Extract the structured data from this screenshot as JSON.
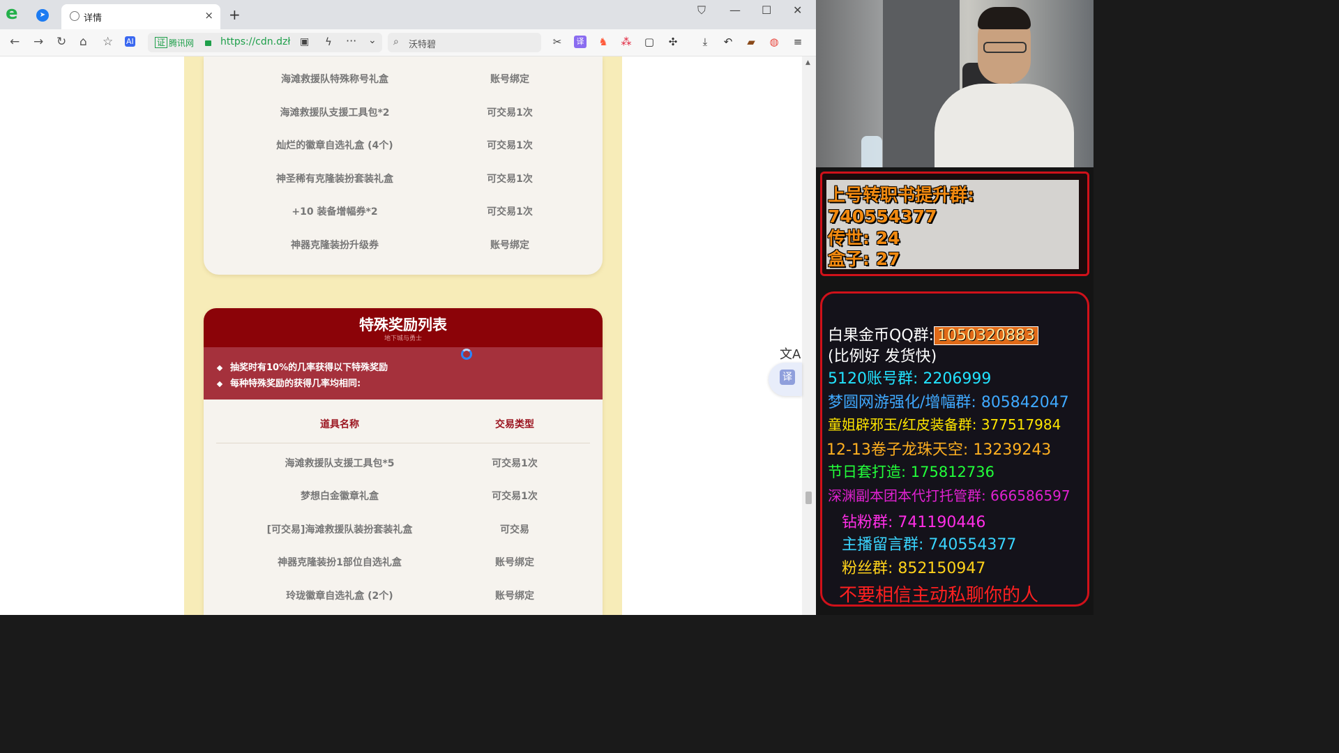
{
  "browser": {
    "tab_title": "详情",
    "tab_close": "×",
    "new_tab": "+",
    "cert_mark": "证",
    "cert_name": "腾讯网",
    "url": "https://cdn.dzł",
    "search_placeholder": "沃特碧"
  },
  "card1": {
    "rows": [
      {
        "name": "海滩救援队特殊称号礼盒",
        "type": "账号绑定"
      },
      {
        "name": "海滩救援队支援工具包*2",
        "type": "可交易1次"
      },
      {
        "name": "灿烂的徽章自选礼盒 (4个)",
        "type": "可交易1次"
      },
      {
        "name": "神圣稀有克隆装扮套装礼盒",
        "type": "可交易1次"
      },
      {
        "name": "+10 装备增幅券*2",
        "type": "可交易1次"
      },
      {
        "name": "神器克隆装扮升级券",
        "type": "账号绑定"
      }
    ]
  },
  "card2": {
    "title": "特殊奖励列表",
    "subtitle": "地下城与勇士",
    "notes": [
      "抽奖时有10%的几率获得以下特殊奖励",
      "每种特殊奖励的获得几率均相同:"
    ],
    "col_name": "道具名称",
    "col_type": "交易类型",
    "rows": [
      {
        "name": "海滩救援队支援工具包*5",
        "type": "可交易1次"
      },
      {
        "name": "梦想白金徽章礼盒",
        "type": "可交易1次"
      },
      {
        "name": "[可交易]海滩救援队装扮套装礼盒",
        "type": "可交易"
      },
      {
        "name": "神器克隆装扮1部位自选礼盒",
        "type": "账号绑定"
      },
      {
        "name": "玲珑徽章自选礼盒 (2个)",
        "type": "账号绑定"
      }
    ]
  },
  "side": {
    "translate_glyph": "文A",
    "fab_glyph": "译"
  },
  "overlay": {
    "panel1": [
      "上号转职书提升群: 740554377",
      "传世: 24",
      "盒子: 27"
    ],
    "qq_label": "白果金币QQ群:",
    "qq_number": "1050320883",
    "qq_note": "(比例好 发货快)",
    "lines": [
      {
        "text": "5120账号群: 2206999",
        "color": "#22e3ff"
      },
      {
        "text": "梦圆网游强化/增幅群: 805842047",
        "color": "#3fa9ff"
      },
      {
        "text": "童姐辟邪玉/红皮装备群: 377517984",
        "color": "#ffe600"
      },
      {
        "text": "12-13卷子龙珠天空: 13239243",
        "color": "#ffb020"
      },
      {
        "text": "节日套打造: 175812736",
        "color": "#22ff3a"
      },
      {
        "text": "深渊副本团本代打托管群: 666586597",
        "color": "#e021d0"
      },
      {
        "text": "钻粉群: 741190446",
        "color": "#ff2ee6"
      },
      {
        "text": "主播留言群: 740554377",
        "color": "#3ad5ff"
      },
      {
        "text": "粉丝群: 852150947",
        "color": "#ffd21a"
      },
      {
        "text": "不要相信主动私聊你的人",
        "color": "#ff2020"
      }
    ]
  }
}
